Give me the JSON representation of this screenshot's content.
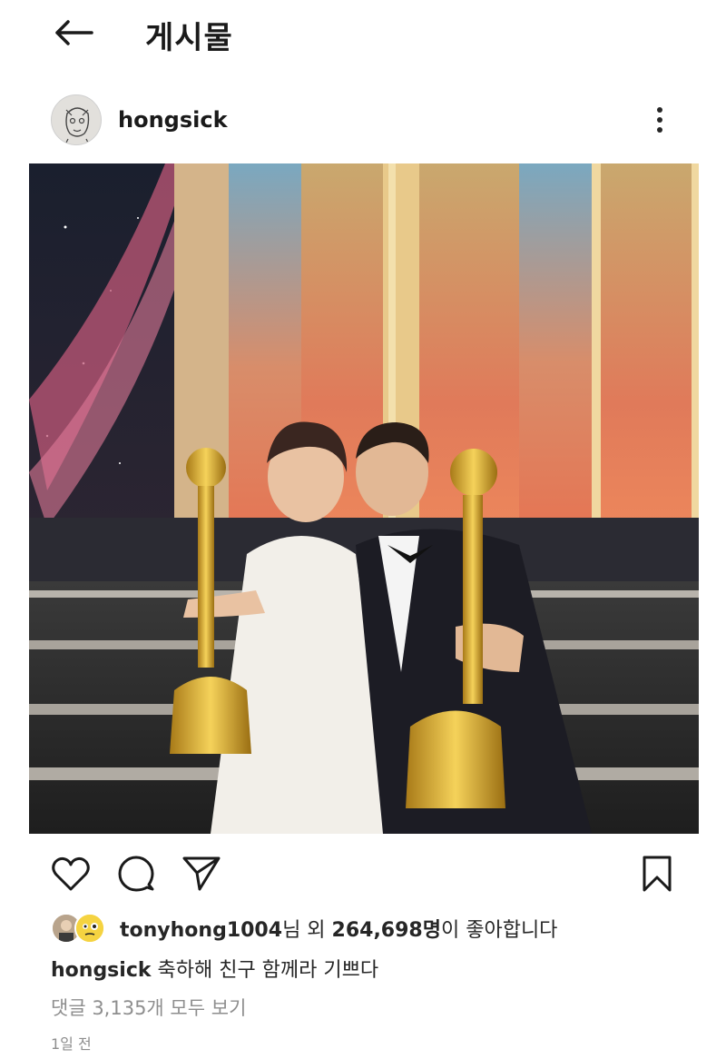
{
  "header": {
    "title": "게시물",
    "back_icon": "arrow-left-icon"
  },
  "post": {
    "username": "hongsick",
    "more_icon": "more-vertical-icon"
  },
  "actions": {
    "like_icon": "heart-icon",
    "comment_icon": "comment-icon",
    "share_icon": "send-icon",
    "save_icon": "bookmark-icon"
  },
  "likes": {
    "user": "tonyhong1004",
    "suffix_1": "님 외 ",
    "count": "264,698명",
    "suffix_2": "이 좋아합니다"
  },
  "caption": {
    "username": "hongsick",
    "text": " 축하해 친구 함께라 기쁘다"
  },
  "comments_link": "댓글 3,135개 모두 보기",
  "time": "1일 전",
  "colors": {
    "text": "#262626",
    "muted": "#8e8e8e",
    "background": "#ffffff"
  }
}
